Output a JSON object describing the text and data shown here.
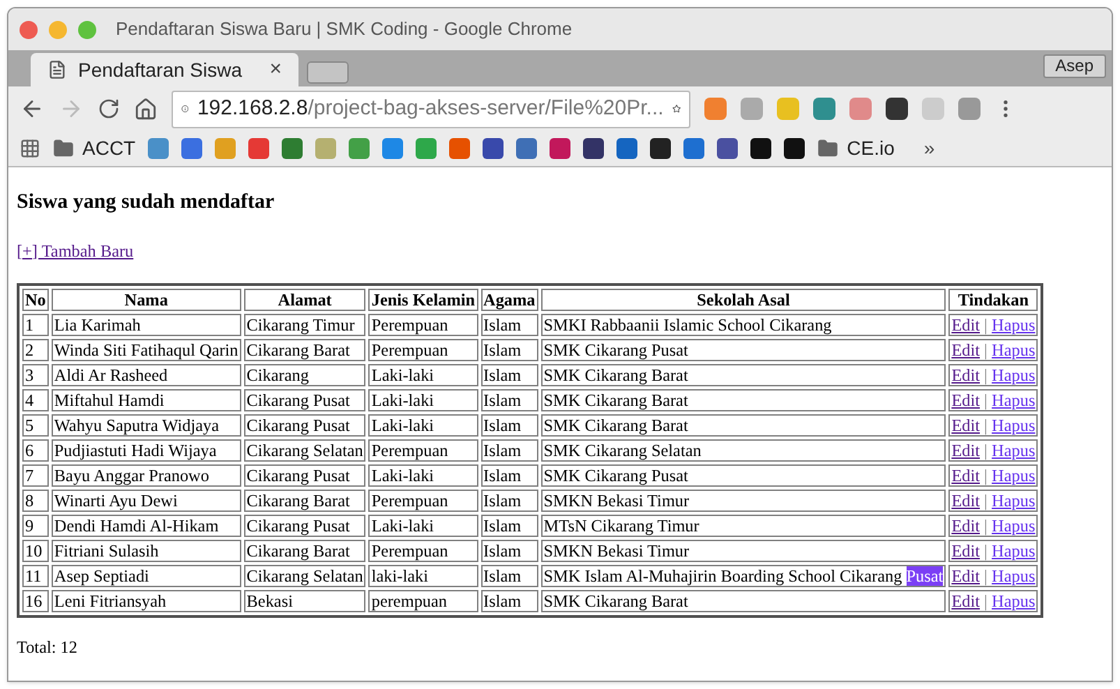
{
  "window": {
    "title": "Pendaftaran Siswa Baru | SMK Coding - Google Chrome"
  },
  "tabs": [
    {
      "label": "Pendaftaran Siswa",
      "close": "×",
      "selected": true
    }
  ],
  "profile": "Asep",
  "address": {
    "host": "192.168.2.8",
    "path": "/project-bag-akses-server/File%20Pr..."
  },
  "bookmarks": {
    "folders": [
      "ACCT",
      "CE.io"
    ],
    "overflow": "»"
  },
  "page": {
    "heading": "Siswa yang sudah mendaftar",
    "add_link": "[+] Tambah Baru",
    "table": {
      "columns": [
        "No",
        "Nama",
        "Alamat",
        "Jenis Kelamin",
        "Agama",
        "Sekolah Asal",
        "Tindakan"
      ],
      "rows": [
        {
          "cells": [
            "1",
            "Lia Karimah",
            "Cikarang Timur",
            "Perempuan",
            "Islam",
            "SMKI Rabbaanii Islamic School Cikarang"
          ],
          "actions": [
            "Edit",
            "|",
            "Hapus"
          ]
        },
        {
          "cells": [
            "2",
            "Winda Siti Fatihaqul Qarin",
            "Cikarang Barat",
            "Perempuan",
            "Islam",
            "SMK Cikarang Pusat"
          ],
          "actions": [
            "Edit",
            "|",
            "Hapus"
          ]
        },
        {
          "cells": [
            "3",
            "Aldi Ar Rasheed",
            "Cikarang",
            "Laki-laki",
            "Islam",
            "SMK Cikarang Barat"
          ],
          "actions": [
            "Edit",
            "|",
            "Hapus"
          ]
        },
        {
          "cells": [
            "4",
            "Miftahul Hamdi",
            "Cikarang Pusat",
            "Laki-laki",
            "Islam",
            "SMK Cikarang Barat"
          ],
          "actions": [
            "Edit",
            "|",
            "Hapus"
          ]
        },
        {
          "cells": [
            "5",
            "Wahyu Saputra Widjaya",
            "Cikarang Pusat",
            "Laki-laki",
            "Islam",
            "SMK Cikarang Barat"
          ],
          "actions": [
            "Edit",
            "|",
            "Hapus"
          ]
        },
        {
          "cells": [
            "6",
            "Pudjiastuti Hadi Wijaya",
            "Cikarang Selatan",
            "Perempuan",
            "Islam",
            "SMK Cikarang Selatan"
          ],
          "actions": [
            "Edit",
            "|",
            "Hapus"
          ]
        },
        {
          "cells": [
            "7",
            "Bayu Anggar Pranowo",
            "Cikarang Pusat",
            "Laki-laki",
            "Islam",
            "SMK Cikarang Pusat"
          ],
          "actions": [
            "Edit",
            "|",
            "Hapus"
          ]
        },
        {
          "cells": [
            "8",
            "Winarti Ayu Dewi",
            "Cikarang Barat",
            "Perempuan",
            "Islam",
            "SMKN Bekasi Timur"
          ],
          "actions": [
            "Edit",
            "|",
            "Hapus"
          ]
        },
        {
          "cells": [
            "9",
            "Dendi Hamdi Al-Hikam",
            "Cikarang Pusat",
            "Laki-laki",
            "Islam",
            "MTsN Cikarang Timur"
          ],
          "actions": [
            "Edit",
            "|",
            "Hapus"
          ]
        },
        {
          "cells": [
            "10",
            "Fitriani Sulasih",
            "Cikarang Barat",
            "Perempuan",
            "Islam",
            "SMKN Bekasi Timur"
          ],
          "actions": [
            "Edit",
            "|",
            "Hapus"
          ]
        },
        {
          "cells": [
            "11",
            "Asep Septiadi",
            "Cikarang Selatan",
            "laki-laki",
            "Islam",
            "SMK Islam Al-Muhajirin Boarding School Cikarang"
          ],
          "selected_text": "Pusat",
          "actions": [
            "Edit",
            "|",
            "Hapus"
          ]
        },
        {
          "cells": [
            "16",
            "Leni Fitriansyah",
            "Bekasi",
            "perempuan",
            "Islam",
            "SMK Cikarang Barat"
          ],
          "actions": [
            "Edit",
            "|",
            "Hapus"
          ]
        }
      ]
    },
    "total": "Total: 12"
  }
}
